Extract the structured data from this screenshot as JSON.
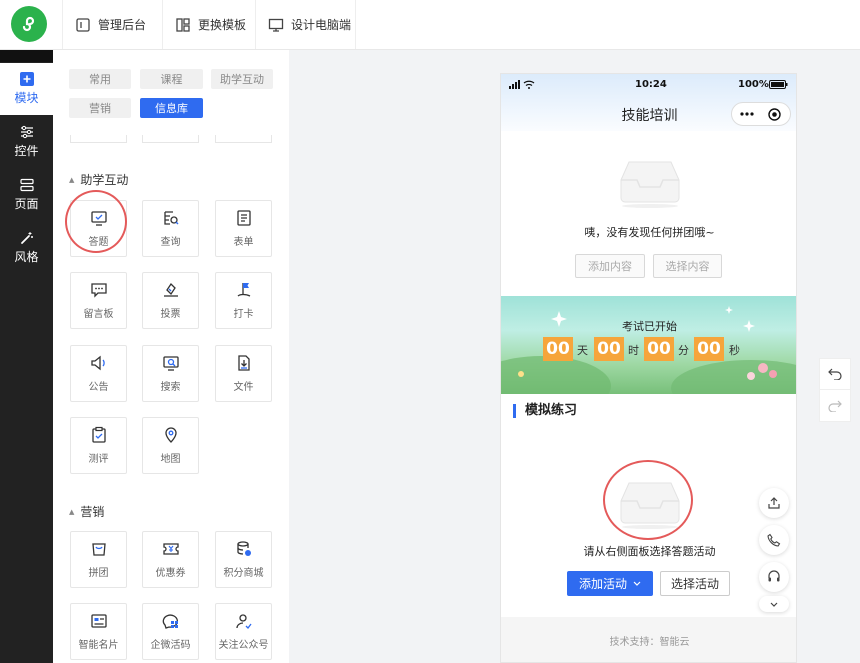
{
  "topbar": {
    "buttons": [
      {
        "label": "管理后台",
        "icon": "admin-icon"
      },
      {
        "label": "更换模板",
        "icon": "template-icon"
      },
      {
        "label": "设计电脑端",
        "icon": "monitor-icon"
      }
    ]
  },
  "leftnav": {
    "items": [
      {
        "label": "模块",
        "icon": "module-plus-icon",
        "active": true
      },
      {
        "label": "控件",
        "icon": "controls-slider-icon"
      },
      {
        "label": "页面",
        "icon": "page-layers-icon"
      },
      {
        "label": "风格",
        "icon": "style-wand-icon"
      }
    ]
  },
  "panel": {
    "tabs": [
      {
        "label": "常用"
      },
      {
        "label": "课程"
      },
      {
        "label": "助学互动"
      },
      {
        "label": "营销"
      },
      {
        "label": "信息库",
        "active": true
      }
    ],
    "section_interact": "助学互动",
    "interact_tiles": [
      {
        "label": "答题",
        "icon": "quiz-icon"
      },
      {
        "label": "查询",
        "icon": "search-doc-icon"
      },
      {
        "label": "表单",
        "icon": "form-icon"
      },
      {
        "label": "留言板",
        "icon": "message-board-icon"
      },
      {
        "label": "投票",
        "icon": "vote-icon"
      },
      {
        "label": "打卡",
        "icon": "checkin-flag-icon"
      },
      {
        "label": "公告",
        "icon": "announcement-icon"
      },
      {
        "label": "搜索",
        "icon": "search-icon"
      },
      {
        "label": "文件",
        "icon": "file-download-icon"
      },
      {
        "label": "测评",
        "icon": "assessment-icon"
      },
      {
        "label": "地图",
        "icon": "map-pin-icon"
      }
    ],
    "section_marketing": "营销",
    "marketing_tiles": [
      {
        "label": "拼团",
        "icon": "group-buy-icon"
      },
      {
        "label": "优惠券",
        "icon": "coupon-icon"
      },
      {
        "label": "积分商城",
        "icon": "points-mall-icon"
      },
      {
        "label": "智能名片",
        "icon": "business-card-icon"
      },
      {
        "label": "企微活码",
        "icon": "wecom-code-icon"
      },
      {
        "label": "关注公众号",
        "icon": "follow-account-icon"
      }
    ]
  },
  "phone": {
    "status_time": "10:24",
    "status_battery": "100%",
    "title": "技能培训",
    "empty_group_text": "咦，没有发现任何拼团哦~",
    "add_content": "添加内容",
    "select_content": "选择内容",
    "banner_title": "考试已开始",
    "countdown": {
      "days": "00",
      "day_unit": "天",
      "hours": "00",
      "hour_unit": "时",
      "minutes": "00",
      "minute_unit": "分",
      "seconds": "00",
      "second_unit": "秒"
    },
    "practice_title": "模拟练习",
    "practice_empty_text": "请从右侧面板选择答题活动",
    "add_activity": "添加活动",
    "select_activity": "选择活动",
    "footer": "技术支持：智能云"
  },
  "colors": {
    "accent": "#2f6bf0",
    "brand_green": "#2bb24c",
    "nav_bg": "#222222",
    "countdown_orange": "#f6a53b",
    "highlight_red": "#e45a5a"
  }
}
